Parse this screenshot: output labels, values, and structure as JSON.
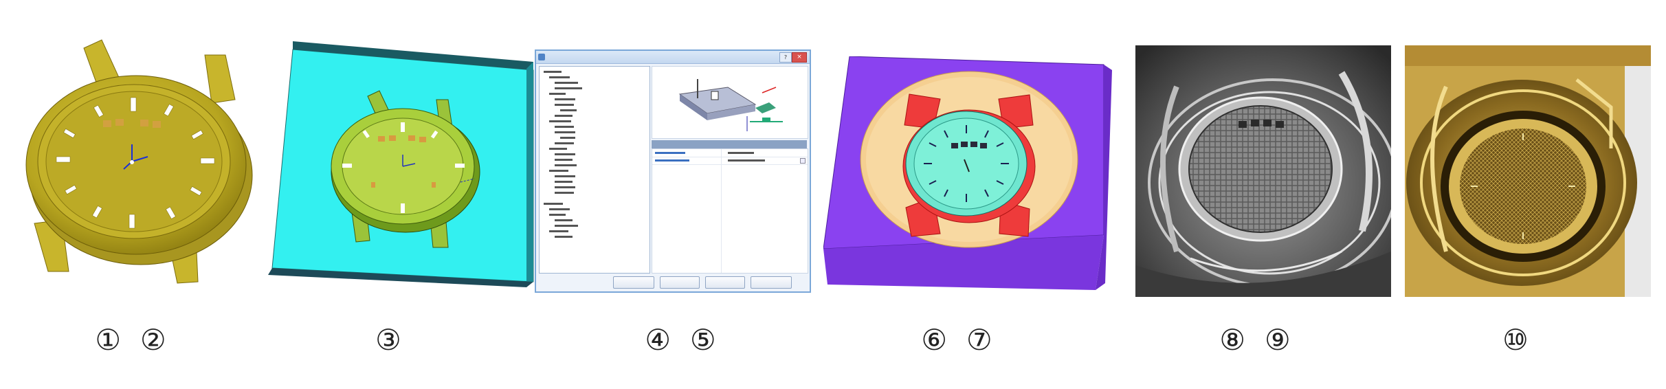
{
  "captions": {
    "p1": [
      "①",
      "②"
    ],
    "p2": [
      "③"
    ],
    "p3": [
      "④",
      "⑤"
    ],
    "p4": [
      "⑥",
      "⑦"
    ],
    "p5": [
      "⑧",
      "⑨"
    ],
    "p6": [
      "⑩"
    ]
  },
  "colors": {
    "watch_gold": "#c9b52e",
    "base_cyan": "#33f0f0",
    "base_purple": "#8a42f0",
    "dial_cyan": "#6fe6cf",
    "band_red": "#ee3b3b",
    "sand": "#f3c98c",
    "metal_dark": "#3a3a3a",
    "brass": "#b8902f",
    "dialog_border": "#7aa7d8"
  },
  "icons": {
    "help": "?",
    "close": "×"
  }
}
